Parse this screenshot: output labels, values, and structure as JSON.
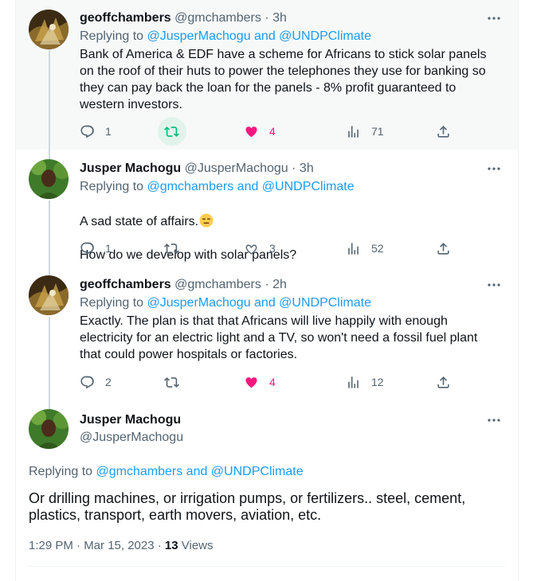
{
  "tweets": [
    {
      "name": "geoffchambers",
      "handle": "@gmchambers",
      "time": "3h",
      "replying_prefix": "Replying to",
      "replying_to": "@JusperMachogu and @UNDPClimate",
      "text": "Bank of America & EDF have a scheme for Africans to stick solar panels on the roof of their huts to power the telephones they use for banking so they can pay back the loan for the panels - 8% profit guaranteed to western investors.",
      "replies": "1",
      "retweets": "",
      "likes": "4",
      "views": "71"
    },
    {
      "name": "Jusper Machogu",
      "handle": "@JusperMachogu",
      "time": "3h",
      "replying_prefix": "Replying to",
      "replying_to": "@gmchambers and @UNDPClimate",
      "text_line1": "A sad state of affairs.",
      "text_line2": "How do we develop with solar panels?",
      "replies": "1",
      "retweets": "",
      "likes": "3",
      "views": "52"
    },
    {
      "name": "geoffchambers",
      "handle": "@gmchambers",
      "time": "2h",
      "replying_prefix": "Replying to",
      "replying_to": "@JusperMachogu and @UNDPClimate",
      "text": "Exactly. The plan is that that Africans will live happily with enough electricity for an electric light and a TV, so won't need a fossil fuel plant that could power  hospitals or factories.",
      "replies": "2",
      "retweets": "",
      "likes": "4",
      "views": "12"
    }
  ],
  "main_tweet": {
    "name": "Jusper Machogu",
    "handle": "@JusperMachogu",
    "replying_prefix": "Replying to",
    "replying_to": "@gmchambers and @UNDPClimate",
    "text": "Or drilling machines, or irrigation pumps, or fertilizers.. steel, cement, plastics, transport, earth movers, aviation, etc.",
    "timestamp": "1:29 PM · Mar 15, 2023 · ",
    "views_count": "13",
    "views_label": " Views"
  },
  "separator": "·",
  "colors": {
    "link": "#1d9bf0",
    "like": "#f91880",
    "retweet_hover": "#00ba7c",
    "muted": "#536471"
  },
  "icons": [
    "reply-icon",
    "retweet-icon",
    "like-icon",
    "views-icon",
    "share-icon",
    "more-icon",
    "expressionless-emoji"
  ]
}
